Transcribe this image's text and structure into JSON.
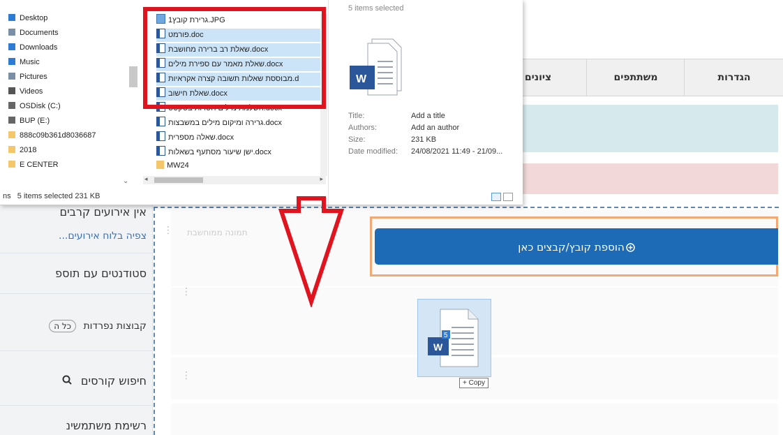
{
  "sidebar": {
    "no_events": "אין אירועים קרבים",
    "view_calendar": "צפיה בלוח אירועים...",
    "students_section": "סטודנטים עם תוספ",
    "separate_groups_label": "קבוצות נפרדות",
    "groups_chip": "כל ה",
    "course_search": "חיפוש קורסים",
    "user_list": "רשימת משתמשינ"
  },
  "tabs": [
    "הגדרות",
    "משתתפים",
    "ציונים"
  ],
  "main": {
    "faded_label": "תמונה ממוחשבת",
    "add_file_button": "הוספת קובץ/קבצים כאן"
  },
  "drag": {
    "copy_tip": "+ Copy",
    "badge": "5"
  },
  "explorer": {
    "tree": [
      {
        "label": "Desktop",
        "icon": "desktop-icon",
        "color": "#2e7bd6"
      },
      {
        "label": "Documents",
        "icon": "documents-icon",
        "color": "#7a8fa6"
      },
      {
        "label": "Downloads",
        "icon": "downloads-icon",
        "color": "#2e7bd6"
      },
      {
        "label": "Music",
        "icon": "music-icon",
        "color": "#2e7bd6"
      },
      {
        "label": "Pictures",
        "icon": "pictures-icon",
        "color": "#7a8fa6"
      },
      {
        "label": "Videos",
        "icon": "videos-icon",
        "color": "#555555"
      },
      {
        "label": "OSDisk (C:)",
        "icon": "drive-icon",
        "color": "#666666"
      },
      {
        "label": "BUP (E:)",
        "icon": "drive-icon",
        "color": "#666666"
      },
      {
        "label": "888c09b361d8036687",
        "icon": "folder-icon",
        "color": "#f5c76b"
      },
      {
        "label": "2018",
        "icon": "folder-icon",
        "color": "#f5c76b"
      },
      {
        "label": "E CENTER",
        "icon": "folder-icon",
        "color": "#f5c76b"
      }
    ],
    "status_prefix": "ns",
    "status": "5 items selected  231 KB",
    "files": [
      {
        "name": "1גרירת קובץ.JPG",
        "selected": false,
        "icon": "image-file-icon"
      },
      {
        "name": "פורמט.doc",
        "selected": true,
        "icon": "word-doc-icon"
      },
      {
        "name": "שאלת רב ברירה מחושבת.docx",
        "selected": true,
        "icon": "word-doc-icon"
      },
      {
        "name": "שאלת מאמר עם ספירת מילים.docx",
        "selected": true,
        "icon": "word-doc-icon"
      },
      {
        "name": "מבוססת שאלות תשובה קצרה אקראיות.d",
        "selected": true,
        "icon": "word-doc-icon"
      },
      {
        "name": "שאלת חישוב.docx",
        "selected": true,
        "icon": "word-doc-icon"
      },
      {
        "name": "השלמת מילים חסרות בטקסט.docx",
        "selected": false,
        "icon": "word-doc-icon"
      },
      {
        "name": "גרירה ומיקום מילים במשבצות.docx",
        "selected": false,
        "icon": "word-doc-icon"
      },
      {
        "name": "שאלה מספרית.docx",
        "selected": false,
        "icon": "word-doc-icon"
      },
      {
        "name": "ישן שיעור מסתעף בשאלות.docx",
        "selected": false,
        "icon": "word-doc-icon"
      },
      {
        "name": "MW24",
        "selected": false,
        "icon": "folder-icon"
      }
    ],
    "preview": {
      "header": "5 items selected",
      "title_label": "Title:",
      "title_value": "Add a title",
      "authors_label": "Authors:",
      "authors_value": "Add an author",
      "size_label": "Size:",
      "size_value": "231 KB",
      "date_label": "Date modified:",
      "date_value": "24/08/2021 11:49 - 21/09..."
    }
  },
  "colors": {
    "highlight_red": "#e0141e",
    "highlight_orange": "#f2a974",
    "button_blue": "#1d6bb7"
  }
}
